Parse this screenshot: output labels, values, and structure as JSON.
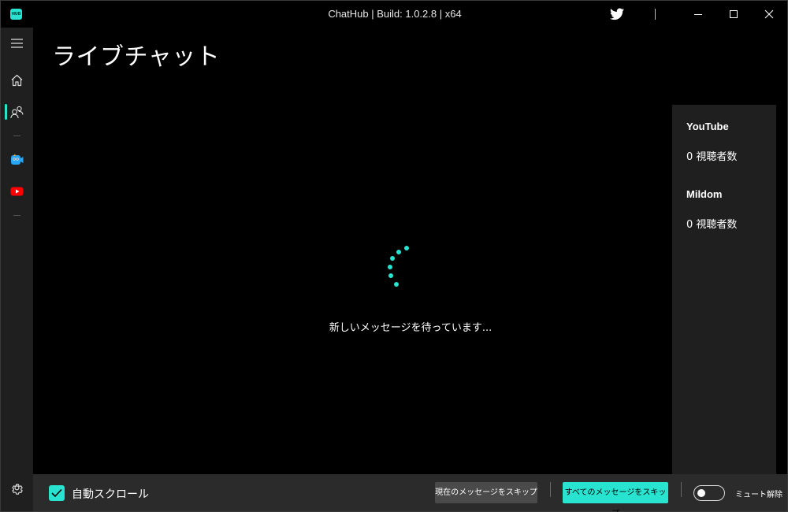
{
  "window": {
    "title": "ChatHub | Build: 1.0.2.8 | x64",
    "logo_text": "HUB",
    "accent": "#27e3d0"
  },
  "titlebar": {
    "icons": [
      "twitter-icon",
      "minimize-icon",
      "maximize-icon",
      "close-icon"
    ]
  },
  "nav": {
    "items": [
      "menu-icon",
      "home-icon",
      "people-icon",
      "mildom-icon",
      "youtube-icon"
    ],
    "active": "people-icon",
    "footer_icon": "gear-icon"
  },
  "main": {
    "title": "ライブチャット",
    "waiting_text": "新しいメッセージを待っています..."
  },
  "side_panel": {
    "platforms": [
      {
        "name": "YouTube",
        "viewers": "0 視聴者数"
      },
      {
        "name": "Mildom",
        "viewers": "0 視聴者数"
      }
    ]
  },
  "bottom": {
    "auto_scroll_label": "自動スクロール",
    "auto_scroll_checked": true,
    "skip_current_label": "現在のメッセージをスキップ",
    "skip_all_label": "すべてのメッセージをスキップ",
    "mute_label": "ミュート解除",
    "mute_on": false
  }
}
